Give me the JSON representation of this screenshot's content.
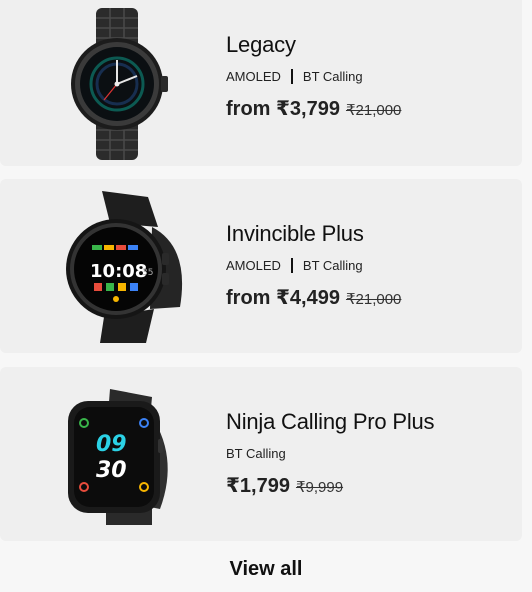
{
  "products": [
    {
      "name": "Legacy",
      "tags": [
        "AMOLED",
        "BT Calling"
      ],
      "price": "from ₹3,799",
      "mrp": "₹21,000",
      "image": "watch-legacy"
    },
    {
      "name": "Invincible Plus",
      "tags": [
        "AMOLED",
        "BT Calling"
      ],
      "price": "from ₹4,499",
      "mrp": "₹21,000",
      "image": "watch-invincible-plus"
    },
    {
      "name": "Ninja Calling Pro Plus",
      "tags": [
        "BT Calling"
      ],
      "price": "₹1,799",
      "mrp": "₹9,999",
      "image": "watch-ninja-calling-pro-plus"
    }
  ],
  "watch_faces": {
    "invincible_time_h": "10",
    "invincible_time_m": "08",
    "invincible_seconds": "35",
    "ninja_time_h": "09",
    "ninja_time_m": "30"
  },
  "footer": {
    "view_all_label": "View all"
  },
  "colors": {
    "card_bg": "#efefef",
    "page_bg": "#f7f7f7",
    "text": "#1a1a1a"
  }
}
